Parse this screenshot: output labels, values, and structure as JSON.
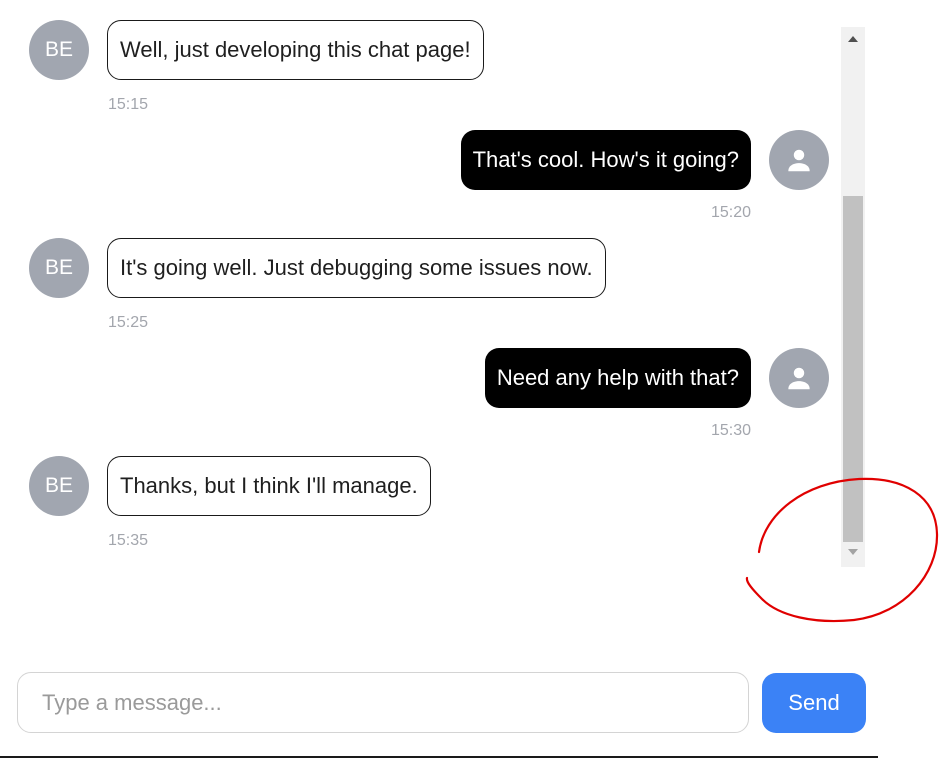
{
  "messages": [
    {
      "direction": "incoming",
      "avatar": "BE",
      "text": "Well, just developing this chat page!",
      "time": "15:15"
    },
    {
      "direction": "outgoing",
      "avatar_icon": "person-icon",
      "text": "That's cool. How's it going?",
      "time": "15:20"
    },
    {
      "direction": "incoming",
      "avatar": "BE",
      "text": "It's going well. Just debugging some issues now.",
      "time": "15:25"
    },
    {
      "direction": "outgoing",
      "avatar_icon": "person-icon",
      "text": "Need any help with that?",
      "time": "15:30"
    },
    {
      "direction": "incoming",
      "avatar": "BE",
      "text": "Thanks, but I think I'll manage.",
      "time": "15:35"
    }
  ],
  "composer": {
    "placeholder": "Type a message...",
    "value": "",
    "send_label": "Send"
  },
  "colors": {
    "avatar_bg": "#a1a6b0",
    "outgoing_bubble": "#000000",
    "send_button": "#3b82f6",
    "annotation": "#e00000"
  }
}
